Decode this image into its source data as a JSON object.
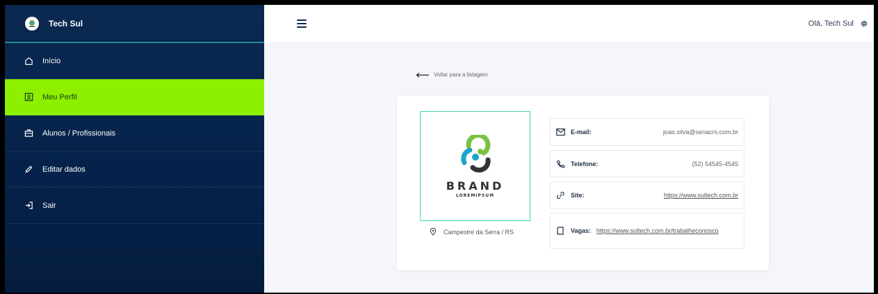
{
  "sidebar": {
    "app_name": "Tech Sul",
    "items": [
      {
        "label": "Início",
        "icon": "home-icon"
      },
      {
        "label": "Meu Perfil",
        "icon": "profile-icon"
      },
      {
        "label": "Alunos / Profissionais",
        "icon": "briefcase-icon"
      },
      {
        "label": "Editar dados",
        "icon": "pencil-icon"
      },
      {
        "label": "Sair",
        "icon": "logout-icon"
      }
    ],
    "active_index": 1,
    "active_color": "#8cf000"
  },
  "header": {
    "greeting": "Olá, Tech Sul"
  },
  "main": {
    "back_label": "Voltar para a listagem",
    "brand": {
      "title": "BRAND",
      "subtitle": "LOREMIPSUM"
    },
    "location": "Campestre da Serra / RS",
    "fields": {
      "email": {
        "label": "E-mail:",
        "value": "joao.silva@senacrs.com.br"
      },
      "phone": {
        "label": "Telefone:",
        "value": "(52) 54545-4545"
      },
      "site": {
        "label": "Site:",
        "value": "https://www.sultech.com.br"
      },
      "jobs": {
        "label": "Vagas:",
        "value": "https://www.sultech.com.br/trabalheconosco"
      }
    }
  },
  "colors": {
    "sidebar_bg": "#0a2850",
    "accent": "#8cf000",
    "teal": "#3fd6b8"
  }
}
